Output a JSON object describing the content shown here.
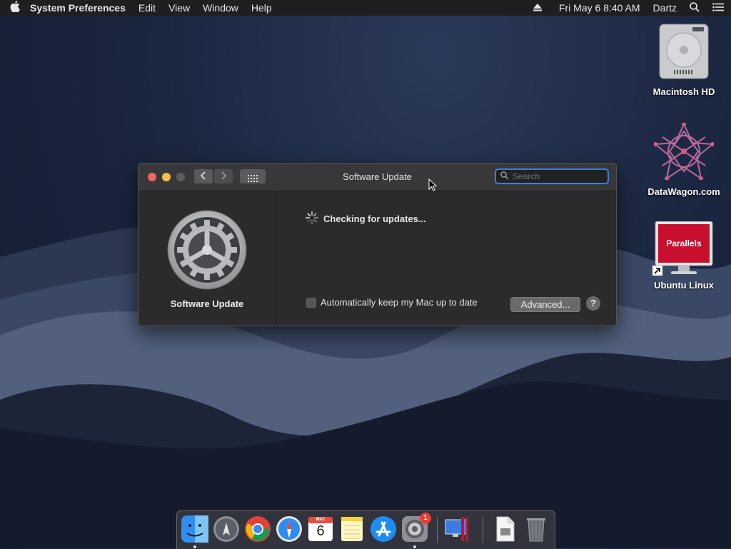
{
  "menubar": {
    "app_name": "System Preferences",
    "menus": [
      "Edit",
      "View",
      "Window",
      "Help"
    ],
    "clock": "Fri May 6  8:40 AM",
    "user": "Dartz"
  },
  "desktop_icons": [
    {
      "label": "Macintosh HD",
      "icon": "hard-drive-icon"
    },
    {
      "label": "DataWagon.com",
      "icon": "datawagon-icon"
    },
    {
      "label": "Ubuntu Linux",
      "icon": "parallels-vm-icon",
      "brand_text": "Parallels"
    }
  ],
  "window": {
    "title": "Software Update",
    "search_placeholder": "Search",
    "sidebar_label": "Software Update",
    "status_text": "Checking for updates...",
    "auto_update_label": "Automatically keep my Mac up to date",
    "advanced_label": "Advanced...",
    "help_label": "?"
  },
  "dock": {
    "items": [
      "Finder",
      "Launchpad",
      "Google Chrome",
      "Safari",
      "Calendar",
      "Notes",
      "App Store",
      "System Preferences",
      "Parallels Desktop",
      "Document",
      "Trash"
    ],
    "calendar_month": "MAY",
    "calendar_day": "6",
    "sysprefs_badge": "1"
  },
  "colors": {
    "close": "#ed6a5e",
    "minimize": "#f5bf4f",
    "zoom": "#5c5c5e",
    "focus_ring": "#3b7fd9"
  }
}
